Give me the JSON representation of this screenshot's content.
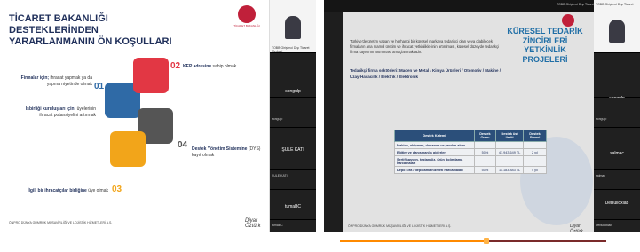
{
  "left": {
    "slide": {
      "title": "TİCARET BAKANLIĞI DESTEKLERİNDEN YARARLANMANIN ÖN KOŞULLARI",
      "logo_caption": "TİCARET BAKANLIĞI",
      "items": [
        {
          "num": "01",
          "text_bold": "Firmalar için;",
          "text": " ihracat yapmak ya da yapma niyetinde olmak"
        },
        {
          "num": "02",
          "text_bold": "KEP adresine",
          "text": " sahip olmak"
        },
        {
          "num": "03",
          "text_bold": "İlgili bir ihracatçılar birliğine",
          "text": " üye olmak"
        },
        {
          "num": "04",
          "text_bold": "Destek Yönetim Sistemine",
          "text": " (DYS) kayıt olmak"
        }
      ],
      "extra_item": {
        "text_bold": "İşbirliği kuruluşları için;",
        "text": " üyelerinin ihracat potansiyelini artırmak"
      },
      "footer": "ÖNPRO DÜNYA GÜMRÜK MÜŞAVİRLİĞİ VE LOJİSTİK HİZMETLERİ A.Ş.",
      "signature": "Diyar Öztürk"
    },
    "participants": [
      {
        "name": "",
        "small": "TOBB Girişimci Dışı Ticaret Merkezi"
      },
      {
        "name": "songulp",
        "small": ""
      },
      {
        "name": "",
        "small": "songulp"
      },
      {
        "name": "ŞULE KATI",
        "small": ""
      },
      {
        "name": "",
        "small": "ŞULE KATI"
      },
      {
        "name": "tumaBC",
        "small": ""
      },
      {
        "name": "",
        "small": "tumaBC"
      }
    ]
  },
  "right": {
    "topbar": "TOBB Girişimci Dışı Ticaret",
    "slide": {
      "title": "KÜRESEL TEDARİK ZİNCİRLERİ YETKİNLİK PROJELERİ",
      "intro": "Türkiye'de üretim yapan ve herhangi bir küresel markaya tedarikçi olan veya olabilecek firmaların ana mamul üretim ve ihracat yetkinliklerinin artırılması, küresel düzeyde tedarikçi firma sayısının artırılması amaçlanmaktadır.",
      "sectors": "Tedarikçi firma sektörleri: Maden ve Metal / Kimya Ürünleri / Otomotiv / Makine / Uzay-Havacılık / Elektrik / Elektronik",
      "table": {
        "headers": [
          "Destek Kalemi",
          "Destek Oranı",
          "Destek üst limiti",
          "Destek Süresi"
        ],
        "rows": [
          [
            "Makine, ekipman, donanım ve yazılım alımı",
            "",
            "",
            ""
          ],
          [
            "Eğitim ve danışmanlık giderleri",
            "50%",
            "41.943.649 TL",
            "2 yıl"
          ],
          [
            "Sertifikasyon, testanaliz, ürün doğrulama harcamaları",
            "",
            "",
            ""
          ],
          [
            "Depo kira / depolama hizmeti harcamaları",
            "50%",
            "11.183.883 TL",
            "4 yıl"
          ]
        ]
      },
      "footer": "ÖNPRO DÜNYA GÜMRÜK MÜŞAVİRLİĞİ VE LOJİSTİK HİZMETLERİ A.Ş.",
      "signature": "Diyar Öztürk"
    },
    "participants": [
      {
        "name": "",
        "small": "TOBB Girişimci Dışı Ticaret"
      },
      {
        "name": "songulp",
        "small": ""
      },
      {
        "name": "",
        "small": "songulp"
      },
      {
        "name": "salmac",
        "small": ""
      },
      {
        "name": "",
        "small": "salmac"
      },
      {
        "name": "UeBuildxlab",
        "small": ""
      },
      {
        "name": "",
        "small": "Uebuildxlab"
      }
    ],
    "video_progress": 0.55
  },
  "colors": {
    "navy": "#1f2f5a",
    "red": "#c0203a",
    "blue_piece": "#2f6aa6",
    "red_piece": "#e23744",
    "gray_piece": "#555555",
    "yellow_piece": "#f2a51a",
    "accent_blue": "#1f6ea6",
    "progress_orange": "#ff8a00"
  }
}
